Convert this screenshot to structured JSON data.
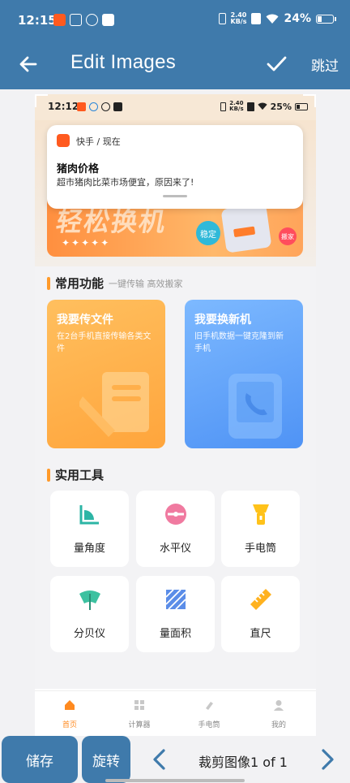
{
  "status_bar": {
    "time": "12:15",
    "net_speed_top": "2.40",
    "net_speed_bottom": "KB/s",
    "battery": "24%"
  },
  "header": {
    "title": "Edit Images",
    "skip": "跳过"
  },
  "screenshot": {
    "status_bar": {
      "time": "12:12",
      "net_speed_top": "2.40",
      "net_speed_bottom": "KB/s",
      "battery": "25%"
    },
    "notification": {
      "app": "快手 / 现在",
      "title": "猪肉价格",
      "body": "超市猪肉比菜市场便宜，原因来了!"
    },
    "banner": {
      "text": "轻松换机",
      "stars": "✦✦✦✦✦",
      "badge_stable": "稳定",
      "badge_move": "搬家"
    },
    "common_section": {
      "title": "常用功能",
      "subtitle": "一键传输 高效搬家"
    },
    "cards": [
      {
        "title": "我要传文件",
        "desc": "在2台手机直接传输各类文件"
      },
      {
        "title": "我要换新机",
        "desc": "旧手机数据一键克隆到新手机"
      }
    ],
    "tools_section": {
      "title": "实用工具"
    },
    "tools": [
      {
        "label": "量角度",
        "icon": "protractor-icon"
      },
      {
        "label": "水平仪",
        "icon": "level-icon"
      },
      {
        "label": "手电筒",
        "icon": "flashlight-icon"
      },
      {
        "label": "分贝仪",
        "icon": "decibel-meter-icon"
      },
      {
        "label": "量面积",
        "icon": "area-measure-icon"
      },
      {
        "label": "直尺",
        "icon": "ruler-icon"
      }
    ],
    "bottom_nav": [
      {
        "label": "首页",
        "icon": "home-icon",
        "active": true
      },
      {
        "label": "计算器",
        "icon": "calculator-icon",
        "active": false
      },
      {
        "label": "手电筒",
        "icon": "flashlight-icon",
        "active": false
      },
      {
        "label": "我的",
        "icon": "profile-icon",
        "active": false
      }
    ]
  },
  "toolbar": {
    "save": "储存",
    "rotate": "旋转",
    "page_label": "裁剪图像1 of 1"
  },
  "colors": {
    "accent": "#3f7aab",
    "orange": "#ff9a2a",
    "blue_card": "#4f93f5"
  }
}
